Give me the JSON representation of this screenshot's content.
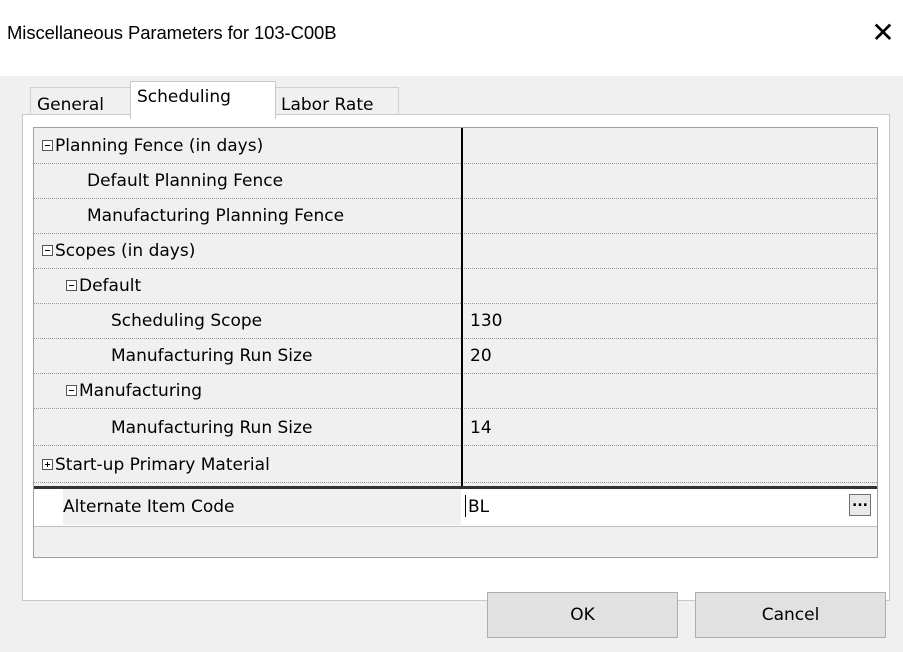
{
  "window": {
    "title": "Miscellaneous Parameters for 103-C00B",
    "close_glyph": "✕"
  },
  "tabs": [
    {
      "label": "General"
    },
    {
      "label": "Scheduling"
    },
    {
      "label": "Labor Rate"
    }
  ],
  "active_tab": "Scheduling",
  "grid": {
    "rows": [
      {
        "name": "Planning Fence (in days)",
        "value": "",
        "expander": "minus"
      },
      {
        "name": "Default Planning Fence",
        "value": ""
      },
      {
        "name": "Manufacturing Planning Fence",
        "value": ""
      },
      {
        "name": "Scopes (in days)",
        "value": "",
        "expander": "minus"
      },
      {
        "name": "Default",
        "value": "",
        "expander": "minus"
      },
      {
        "name": "Scheduling Scope",
        "value": "130"
      },
      {
        "name": "Manufacturing Run Size",
        "value": "20"
      },
      {
        "name": "Manufacturing",
        "value": "",
        "expander": "minus"
      },
      {
        "name": "Manufacturing Run Size",
        "value": "14"
      },
      {
        "name": "Start-up Primary Material",
        "value": "",
        "expander": "plus"
      }
    ],
    "selected": {
      "name": "Alternate Item Code",
      "value": "BL",
      "ellipsis": "..."
    }
  },
  "buttons": {
    "ok": "OK",
    "cancel": "Cancel"
  }
}
